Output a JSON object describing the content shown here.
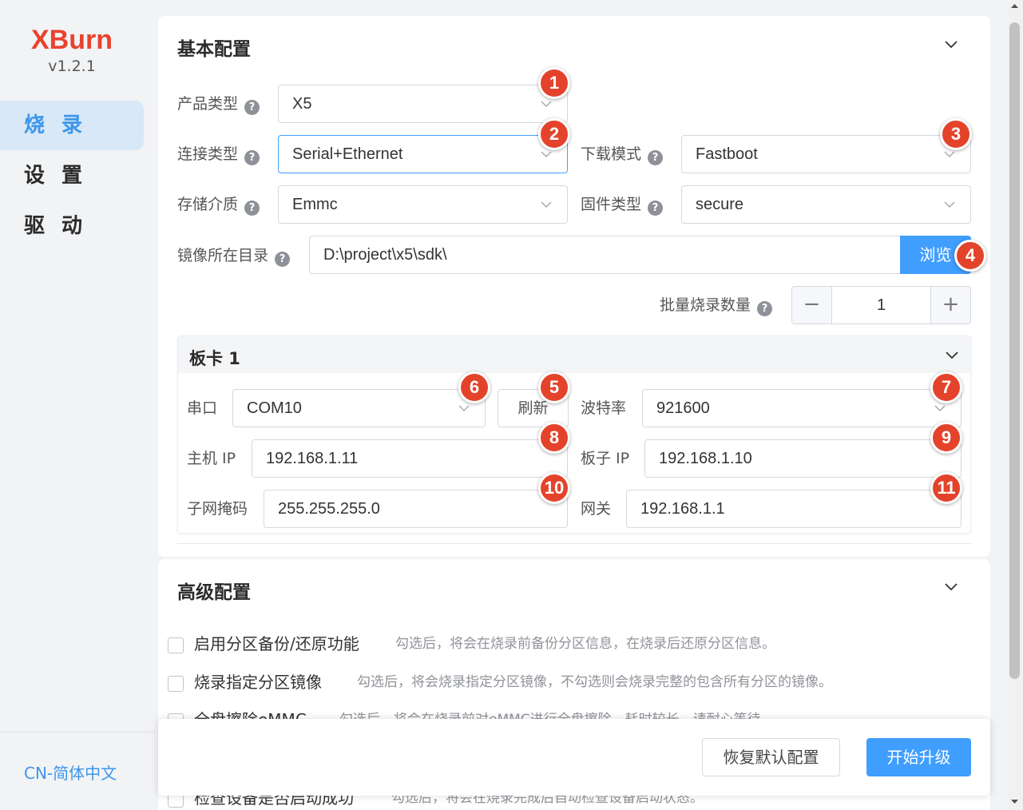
{
  "app": {
    "logo": "XBurn",
    "version": "v1.2.1"
  },
  "sidebar": {
    "items": [
      {
        "label": "烧 录",
        "active": true
      },
      {
        "label": "设 置"
      },
      {
        "label": "驱 动"
      }
    ],
    "language": "CN-简体中文"
  },
  "basic": {
    "title": "基本配置",
    "product_type": {
      "label": "产品类型",
      "value": "X5"
    },
    "connect_type": {
      "label": "连接类型",
      "value": "Serial+Ethernet"
    },
    "download_mode": {
      "label": "下载模式",
      "value": "Fastboot"
    },
    "storage": {
      "label": "存储介质",
      "value": "Emmc"
    },
    "firmware_type": {
      "label": "固件类型",
      "value": "secure"
    },
    "image_dir": {
      "label": "镜像所在目录",
      "value": "D:\\project\\x5\\sdk\\",
      "browse": "浏览"
    },
    "batch": {
      "label": "批量烧录数量",
      "value": "1",
      "minus": "−",
      "plus": "+"
    }
  },
  "board": {
    "title": "板卡 1",
    "serial": {
      "label": "串口",
      "value": "COM10",
      "refresh": "刷新"
    },
    "baud": {
      "label": "波特率",
      "value": "921600"
    },
    "host_ip": {
      "label": "主机 IP",
      "value": "192.168.1.11"
    },
    "board_ip": {
      "label": "板子 IP",
      "value": "192.168.1.10"
    },
    "netmask": {
      "label": "子网掩码",
      "value": "255.255.255.0"
    },
    "gateway": {
      "label": "网关",
      "value": "192.168.1.1"
    }
  },
  "advanced": {
    "title": "高级配置",
    "options": [
      {
        "label": "启用分区备份/还原功能",
        "desc": "勾选后，将会在烧录前备份分区信息，在烧录后还原分区信息。"
      },
      {
        "label": "烧录指定分区镜像",
        "desc": "勾选后，将会烧录指定分区镜像，不勾选则会烧录完整的包含所有分区的镜像。"
      },
      {
        "label": "全盘擦除eMMC",
        "desc": "勾选后，将会在烧录前对eMMC进行全盘擦除，耗时较长，请耐心等待。"
      },
      {
        "label": "检查设备是否启动成功",
        "desc": "勾选后，将会在烧录完成后自动检查设备启动状态。"
      }
    ]
  },
  "footer": {
    "reset": "恢复默认配置",
    "start": "开始升级"
  },
  "badges": [
    "1",
    "2",
    "3",
    "4",
    "5",
    "6",
    "7",
    "8",
    "9",
    "10",
    "11"
  ],
  "colors": {
    "accent": "#409eff",
    "logo": "#e8432e",
    "badge": "#e4432b",
    "active_nav_bg": "#d8e8f7"
  },
  "icons": {
    "dropdown": "chevron-down-icon",
    "help": "question-circle-icon",
    "collapse": "chevron-down-icon"
  }
}
